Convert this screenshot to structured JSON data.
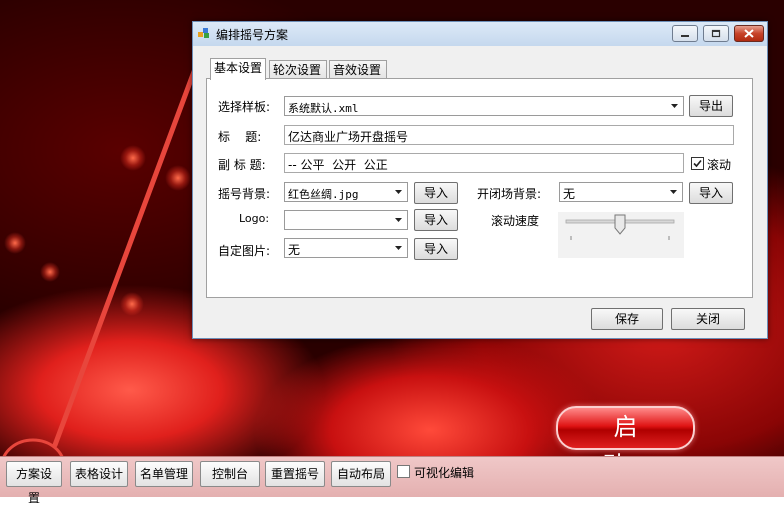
{
  "dialog": {
    "title": "编排摇号方案",
    "tabs": [
      {
        "label": "基本设置",
        "active": true
      },
      {
        "label": "轮次设置",
        "active": false
      },
      {
        "label": "音效设置",
        "active": false
      }
    ],
    "template": {
      "label": "选择样板:",
      "value": "系统默认.xml",
      "button": "导出"
    },
    "title_field": {
      "label": "标    题:",
      "value": "亿达商业广场开盘摇号"
    },
    "subtitle_field": {
      "label": "副 标 题:",
      "value": "-- 公平  公开  公正",
      "scroll_label": "滚动",
      "scroll_checked": true
    },
    "bg": {
      "label": "摇号背景:",
      "value": "红色丝绸.jpg",
      "button": "导入"
    },
    "logo": {
      "label": "Logo:",
      "value": "",
      "button": "导入"
    },
    "custom_image": {
      "label": "自定图片:",
      "value": "无",
      "button": "导入"
    },
    "open_close_bg": {
      "label": "开闭场背景:",
      "value": "无",
      "button": "导入"
    },
    "scroll_speed": {
      "label": "滚动速度",
      "level_percent": 50
    },
    "save_button": "保存",
    "close_button": "关闭"
  },
  "start_button": "启 动",
  "toolbar": {
    "buttons": [
      "方案设置",
      "表格设计",
      "名单管理",
      "控制台",
      "重置摇号",
      "自动布局"
    ],
    "visual_edit_label": "可视化编辑",
    "visual_edit_checked": false
  },
  "colors": {
    "annotation": "#e8463c",
    "titlebar": "#c5d8ee",
    "start_button": "#e01414"
  }
}
